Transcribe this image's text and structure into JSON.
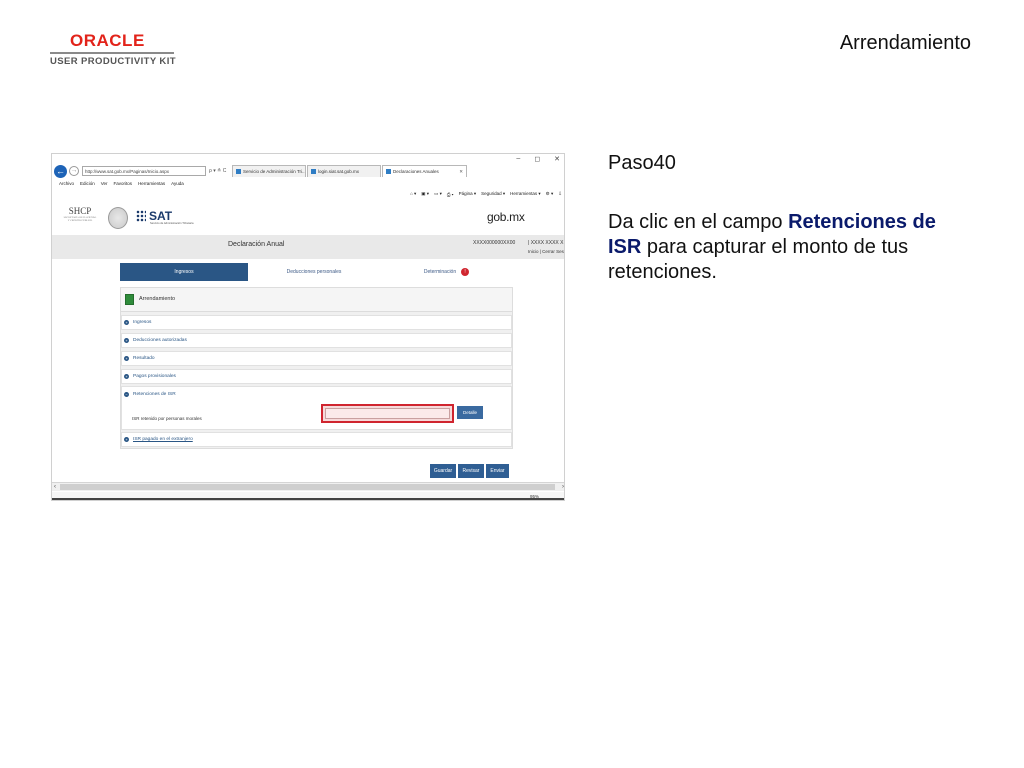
{
  "slide": {
    "logo_brand": "ORACLE",
    "logo_product": "USER PRODUCTIVITY KIT",
    "title": "Arrendamiento",
    "step_label": "Paso40",
    "instruction": {
      "pre": "Da clic en el campo ",
      "highlight": "Retenciones de ISR",
      "post": " para capturar el monto de tus retenciones."
    }
  },
  "browser": {
    "window_controls": [
      "–",
      "◻",
      "✕"
    ],
    "address": "http://www.sat.gob.mx/Paginas/Inicio.aspx",
    "address_tools": "ρ ▾ ≙ C",
    "tabs": [
      {
        "label": "Servicio de Administración Tri...",
        "active": false
      },
      {
        "label": "login.siat.sat.gob.mx",
        "active": false
      },
      {
        "label": "Declaraciones Anuales",
        "active": true
      }
    ],
    "menu": [
      "Archivo",
      "Edición",
      "Ver",
      "Favoritos",
      "Herramientas",
      "Ayuda"
    ],
    "commands": [
      "⌂ ▾",
      "▣ ▾",
      "▭ ▾",
      "⎙ ▾",
      "Página ▾",
      "Seguridad ▾",
      "Herramientas ▾",
      "⚙ ▾",
      "⇩"
    ],
    "zoom": "95%"
  },
  "site": {
    "shcp_title": "SHCP",
    "shcp_sub": "SECRETARÍA DE HACIENDA Y CRÉDITO PÚBLICO",
    "sat_title": "SAT",
    "sat_sub": "Servicio de Administración Tributaria",
    "gob": "gob.mx",
    "page_title": "Declaración Anual",
    "rfc": "XXXX000000XX00",
    "user_name": "| XXXX XXXX X",
    "user_links": "Inicio | Cerrar Sesi"
  },
  "steps": {
    "tabs": [
      {
        "label": "Ingresos",
        "active": true
      },
      {
        "label": "Deducciones personales",
        "active": false
      },
      {
        "label": "Determinación",
        "active": false
      }
    ],
    "badge": "!"
  },
  "panel": {
    "title": "Arrendamiento",
    "rows": [
      {
        "label": "Ingresos"
      },
      {
        "label": "Deducciones autorizadas"
      },
      {
        "label": "Resultado"
      },
      {
        "label": "Pagos provisionales"
      }
    ],
    "isr_section": "Retenciones de ISR",
    "isr_field_label": "ISR retenido por personas morales",
    "isr_value": "",
    "detalle": "Detalle",
    "extranjero": "ISR pagado en el extranjero"
  },
  "actions": {
    "guardar": "Guardar",
    "revisar": "Revisar",
    "enviar": "Enviar"
  },
  "colors": {
    "oracle_red": "#e2231a",
    "sat_blue": "#2a5685",
    "highlight_red": "#d0252f"
  }
}
